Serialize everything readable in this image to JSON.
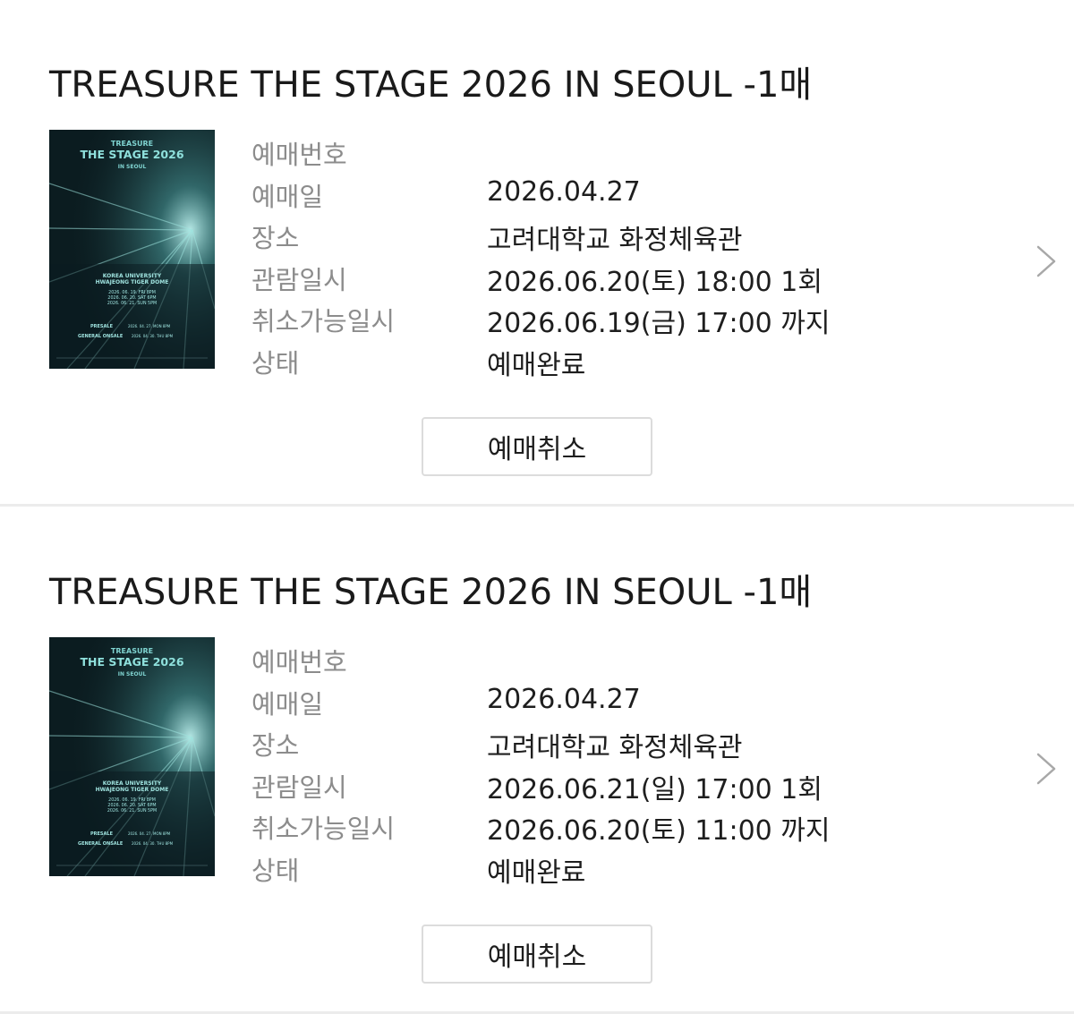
{
  "bookings": [
    {
      "title": "TREASURE THE STAGE 2026 IN SEOUL  -1매",
      "poster": {
        "line1": "TREASURE",
        "line2": "THE STAGE 2026",
        "line3": "IN SEOUL",
        "venue1": "KOREA UNIVERSITY",
        "venue2": "HWAJEONG TIGER DOME",
        "date1": "2026. 06. 19. FRI 8PM",
        "date2": "2026. 06. 20. SAT 6PM",
        "date3": "2026. 06. 21. SUN 5PM",
        "presale_label": "PRESALE",
        "presale_date": "2026. 04. 27. MON 8PM",
        "onsale_label": "GENERAL ONSALE",
        "onsale_date": "2026. 04. 30. THU 8PM"
      },
      "rows": [
        {
          "label": "예매번호",
          "value": ""
        },
        {
          "label": "예매일",
          "value": "2026.04.27"
        },
        {
          "label": "장소",
          "value": "고려대학교 화정체육관"
        },
        {
          "label": "관람일시",
          "value": "2026.06.20(토) 18:00 1회"
        },
        {
          "label": "취소가능일시",
          "value": "2026.06.19(금) 17:00 까지"
        },
        {
          "label": "상태",
          "value": "예매완료"
        }
      ],
      "cancel_label": "예매취소"
    },
    {
      "title": "TREASURE THE STAGE 2026 IN SEOUL  -1매",
      "poster": {
        "line1": "TREASURE",
        "line2": "THE STAGE 2026",
        "line3": "IN SEOUL",
        "venue1": "KOREA UNIVERSITY",
        "venue2": "HWAJEONG TIGER DOME",
        "date1": "2026. 06. 19. FRI 8PM",
        "date2": "2026. 06. 20. SAT 6PM",
        "date3": "2026. 06. 21. SUN 5PM",
        "presale_label": "PRESALE",
        "presale_date": "2026. 04. 27. MON 8PM",
        "onsale_label": "GENERAL ONSALE",
        "onsale_date": "2026. 04. 30. THU 8PM"
      },
      "rows": [
        {
          "label": "예매번호",
          "value": ""
        },
        {
          "label": "예매일",
          "value": "2026.04.27"
        },
        {
          "label": "장소",
          "value": "고려대학교 화정체육관"
        },
        {
          "label": "관람일시",
          "value": "2026.06.21(일) 17:00 1회"
        },
        {
          "label": "취소가능일시",
          "value": "2026.06.20(토) 11:00 까지"
        },
        {
          "label": "상태",
          "value": "예매완료"
        }
      ],
      "cancel_label": "예매취소"
    }
  ],
  "icons": {
    "chevron": "chevron-right-icon"
  },
  "colors": {
    "label": "#8c8c8c",
    "value": "#1e1e1e",
    "divider": "#ececec",
    "button_border": "#dcdcdc",
    "poster_bg": "#0b1c20",
    "poster_accent": "#7fd3d0"
  }
}
